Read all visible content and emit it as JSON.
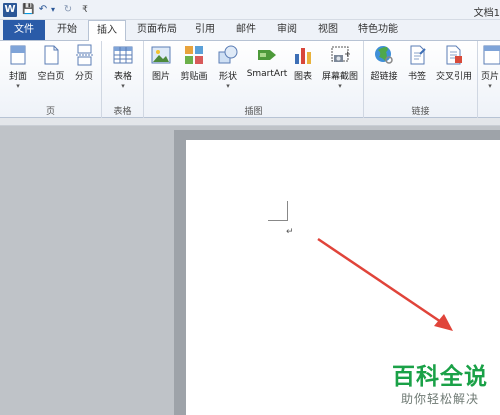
{
  "titlebar": {
    "word_logo": "W",
    "save": "💾",
    "undo": "↶",
    "undo_dd": "▾",
    "redo": "↻",
    "customize": "₹",
    "doc_title": "文档1"
  },
  "tabs": [
    "文件",
    "开始",
    "插入",
    "页面布局",
    "引用",
    "邮件",
    "审阅",
    "视图",
    "特色功能"
  ],
  "ribbon": {
    "groups": {
      "pages": "页",
      "tables": "表格",
      "illustrations": "插图",
      "links": "链接"
    },
    "buttons": {
      "cover": "封面",
      "blank_page": "空白页",
      "page_break": "分页",
      "table": "表格",
      "picture": "图片",
      "clipart": "剪贴画",
      "shapes": "形状",
      "smartart": "SmartArt",
      "chart": "图表",
      "screenshot": "屏幕截图",
      "hyperlink": "超链接",
      "bookmark": "书签",
      "cross_ref": "交叉引用",
      "header": "页片"
    },
    "dropdown_glyph": "▾"
  },
  "document": {
    "paragraph_mark": "↵"
  },
  "watermark": {
    "title": "百科全说",
    "subtitle": "助你轻松解决"
  },
  "colors": {
    "file_tab": "#2a5ba8",
    "arrow": "#e0443a",
    "watermark_green": "#1aa147"
  }
}
